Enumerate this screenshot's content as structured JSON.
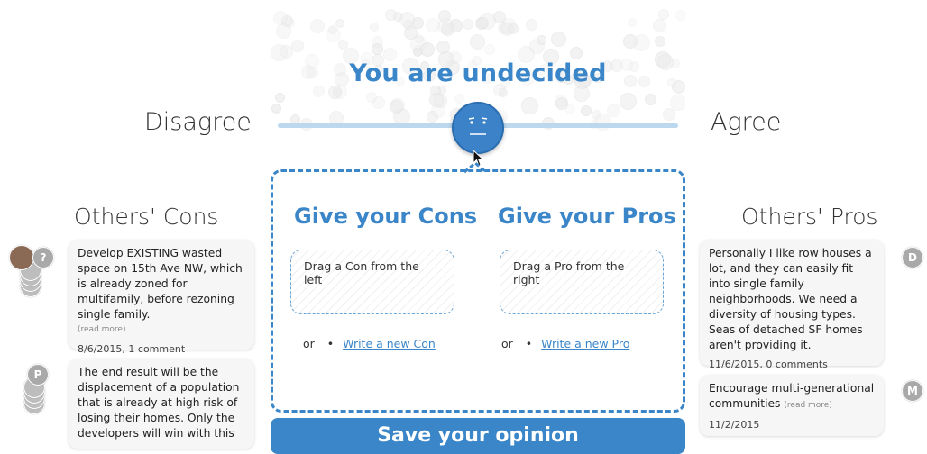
{
  "headline": "You are undecided",
  "scale": {
    "disagree_label": "Disagree",
    "agree_label": "Agree",
    "position": 0.5
  },
  "others_cons": {
    "title": "Others' Cons",
    "items": [
      {
        "text": "Develop EXISTING wasted space on 15th Ave NW, which is already zoned for multifamily, before rezoning single family.",
        "read_more": "(read more)",
        "meta": "8/6/2015, 1 comment",
        "avatar_letter": "?"
      },
      {
        "text": "The end result will be the displacement of a population that is already at high risk of losing their homes. Only the developers will win with this",
        "avatar_letter": "P"
      }
    ]
  },
  "others_pros": {
    "title": "Others' Pros",
    "items": [
      {
        "text": "Personally I like row houses a lot, and they can easily fit into single family neighborhoods. We need a diversity of housing types. Seas of detached SF homes aren't providing it.",
        "meta": "11/6/2015, 0 comments",
        "avatar_letter": "D"
      },
      {
        "text": "Encourage multi-generational communities",
        "read_more": "(read more)",
        "meta": "11/2/2015",
        "avatar_letter": "M"
      }
    ]
  },
  "give_cons": {
    "title": "Give your Cons",
    "drop_hint": "Drag a Con from the left",
    "or_label": "or",
    "write_link": "Write a new Con"
  },
  "give_pros": {
    "title": "Give your Pros",
    "drop_hint": "Drag a Pro from the right",
    "or_label": "or",
    "write_link": "Write a new Pro"
  },
  "submit_label": "Save your opinion",
  "colors": {
    "accent": "#3a86c8",
    "track": "#bcd8ee"
  }
}
